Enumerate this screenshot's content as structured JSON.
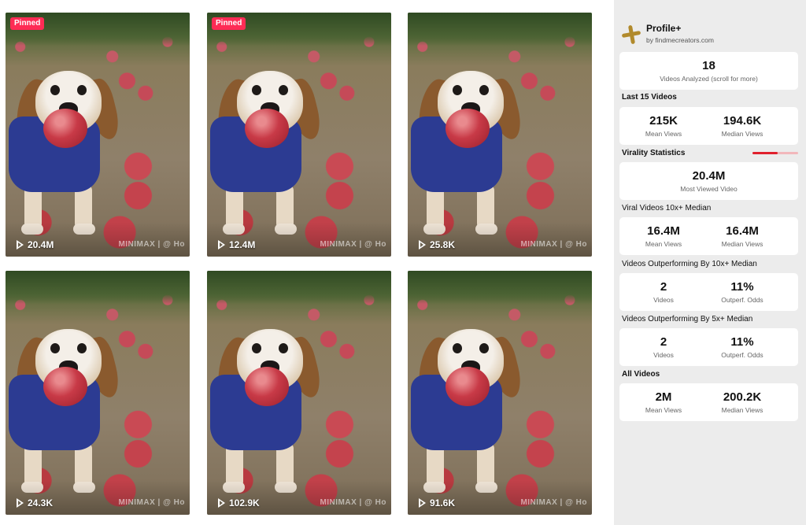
{
  "videos": [
    {
      "pinned": "Pinned",
      "views": "20.4M",
      "watermark": "MINIMAX | @ Ho"
    },
    {
      "pinned": "Pinned",
      "views": "12.4M",
      "watermark": "MINIMAX | @ Ho"
    },
    {
      "pinned": "",
      "views": "25.8K",
      "watermark": "MINIMAX | @ Ho"
    },
    {
      "pinned": "",
      "views": "24.3K",
      "watermark": "MINIMAX | @ Ho"
    },
    {
      "pinned": "",
      "views": "102.9K",
      "watermark": "MINIMAX | @ Ho"
    },
    {
      "pinned": "",
      "views": "91.6K",
      "watermark": "MINIMAX | @ Ho"
    }
  ],
  "panel": {
    "title": "Profile+",
    "subtitle": "by findmecreators.com",
    "analyzed": {
      "value": "18",
      "label": "Videos Analyzed (scroll for more)"
    },
    "last15": {
      "heading": "Last 15 Videos",
      "mean": {
        "value": "215K",
        "label": "Mean Views"
      },
      "median": {
        "value": "194.6K",
        "label": "Median Views"
      }
    },
    "virality": {
      "heading": "Virality Statistics",
      "level": 0.55,
      "most_viewed": {
        "value": "20.4M",
        "label": "Most Viewed Video"
      }
    },
    "viral10x": {
      "heading": "Viral Videos 10x+ Median",
      "mean": {
        "value": "16.4M",
        "label": "Mean Views"
      },
      "median": {
        "value": "16.4M",
        "label": "Median Views"
      }
    },
    "outperf10x": {
      "heading": "Videos Outperforming By 10x+ Median",
      "videos": {
        "value": "2",
        "label": "Videos"
      },
      "odds": {
        "value": "11%",
        "label": "Outperf. Odds"
      }
    },
    "outperf5x": {
      "heading": "Videos Outperforming By 5x+ Median",
      "videos": {
        "value": "2",
        "label": "Videos"
      },
      "odds": {
        "value": "11%",
        "label": "Outperf. Odds"
      }
    },
    "all": {
      "heading": "All Videos",
      "mean": {
        "value": "2M",
        "label": "Mean Views"
      },
      "median": {
        "value": "200.2K",
        "label": "Median Views"
      }
    }
  },
  "colors": {
    "pinned": "#fe2c55",
    "accent": "#e0202d",
    "panel_bg": "#ececec"
  }
}
